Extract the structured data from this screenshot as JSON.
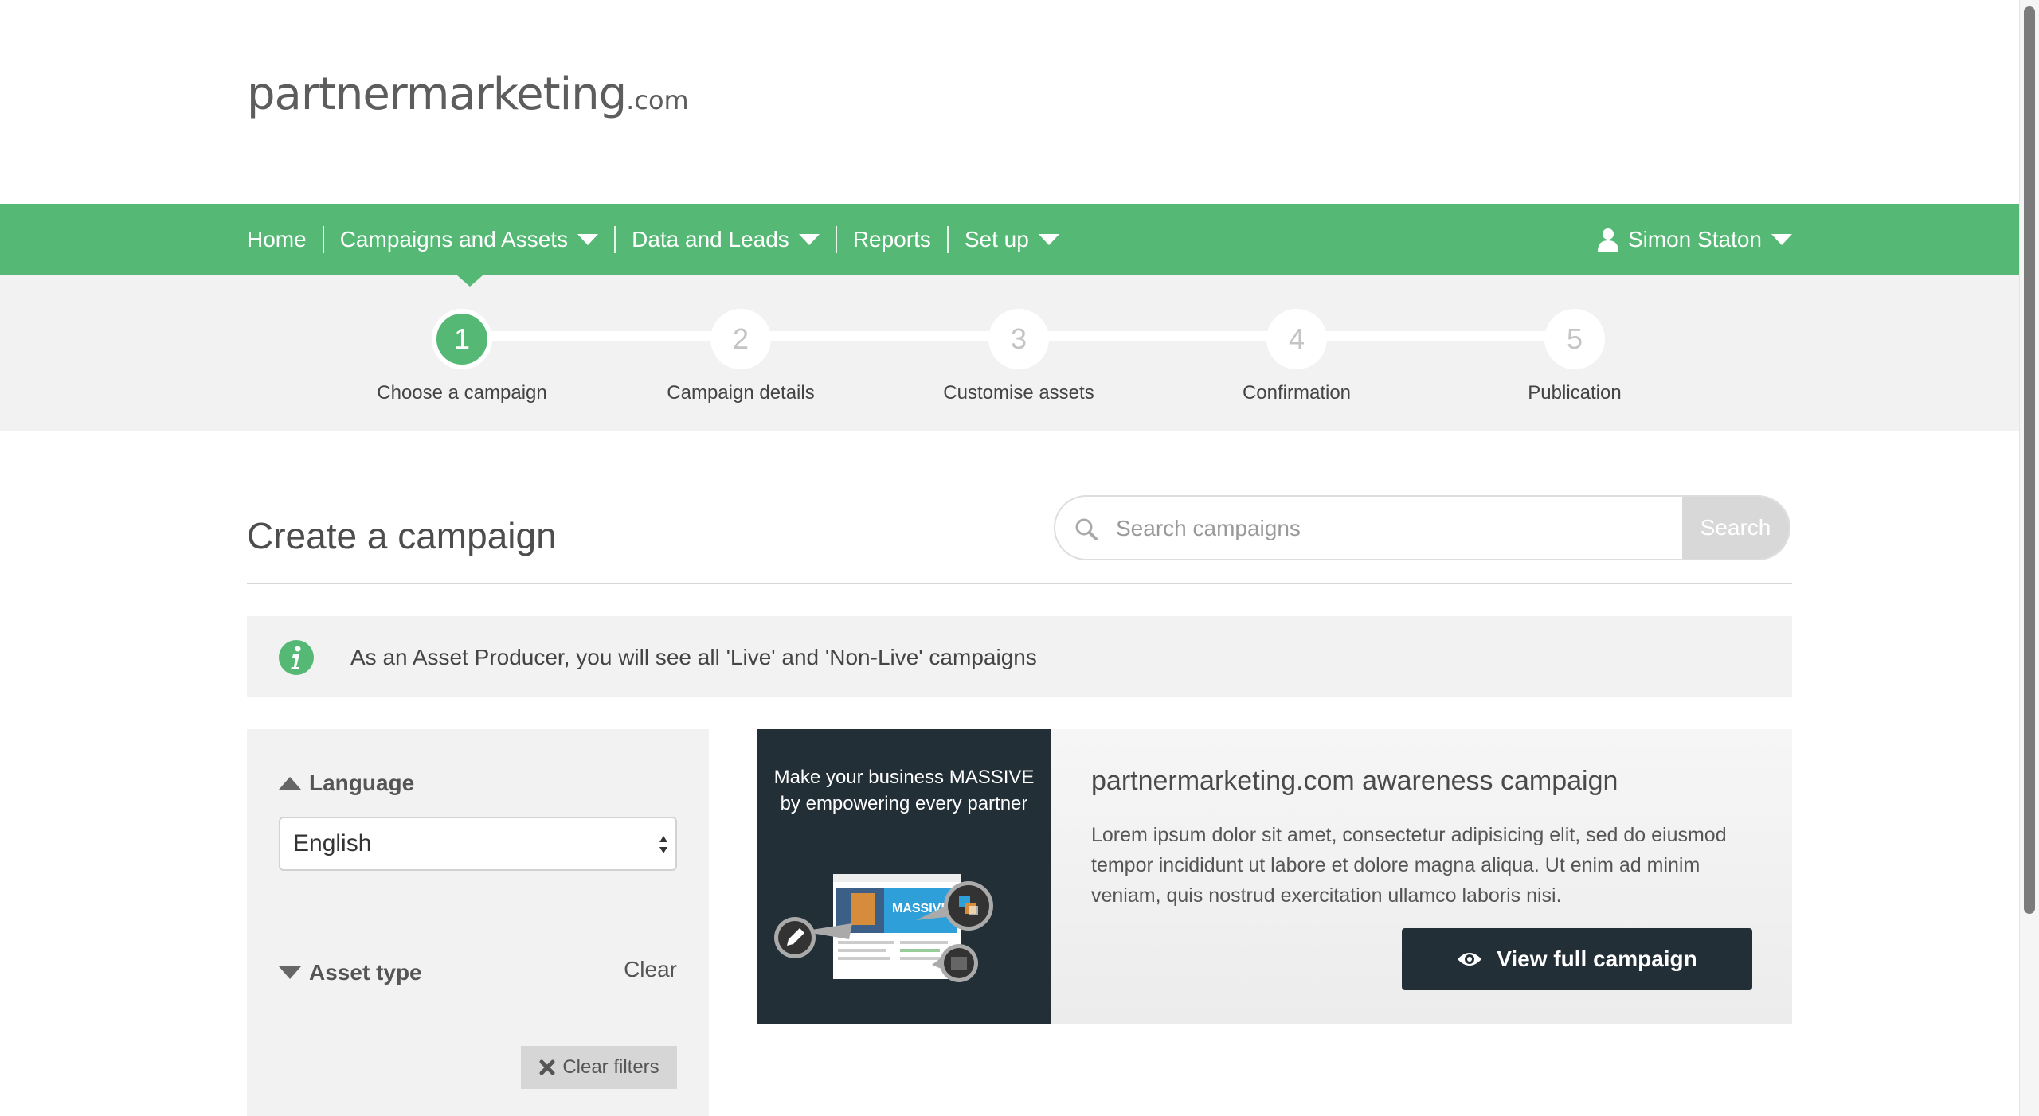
{
  "logo": {
    "brand": "partnermarketing",
    "suffix": ".com"
  },
  "nav": {
    "items": [
      {
        "label": "Home",
        "dropdown": false
      },
      {
        "label": "Campaigns and Assets",
        "dropdown": true
      },
      {
        "label": "Data and Leads",
        "dropdown": true
      },
      {
        "label": "Reports",
        "dropdown": false
      },
      {
        "label": "Set up",
        "dropdown": true
      }
    ],
    "user": "Simon Staton",
    "color": "#55b975"
  },
  "steps": [
    {
      "number": "1",
      "label": "Choose a campaign",
      "active": true
    },
    {
      "number": "2",
      "label": "Campaign details",
      "active": false
    },
    {
      "number": "3",
      "label": "Customise assets",
      "active": false
    },
    {
      "number": "4",
      "label": "Confirmation",
      "active": false
    },
    {
      "number": "5",
      "label": "Publication",
      "active": false
    }
  ],
  "page": {
    "title": "Create a campaign"
  },
  "search": {
    "placeholder": "Search campaigns",
    "button": "Search"
  },
  "info": {
    "text": "As an Asset Producer, you will see all 'Live' and 'Non-Live' campaigns"
  },
  "filters": {
    "language_label": "Language",
    "language_value": "English",
    "asset_type_label": "Asset type",
    "clear": "Clear",
    "clear_filters": "Clear filters"
  },
  "campaign": {
    "thumb_text": "Make your business MASSIVE by empowering every partner",
    "thumb_badge": "MASSIVE",
    "title": "partnermarketing.com awareness campaign",
    "description": "Lorem ipsum dolor sit amet, consectetur adipisicing elit, sed do eiusmod tempor incididunt ut labore et dolore magna aliqua. Ut enim ad minim veniam, quis nostrud exercitation ullamco laboris nisi.",
    "button": "View full campaign"
  }
}
